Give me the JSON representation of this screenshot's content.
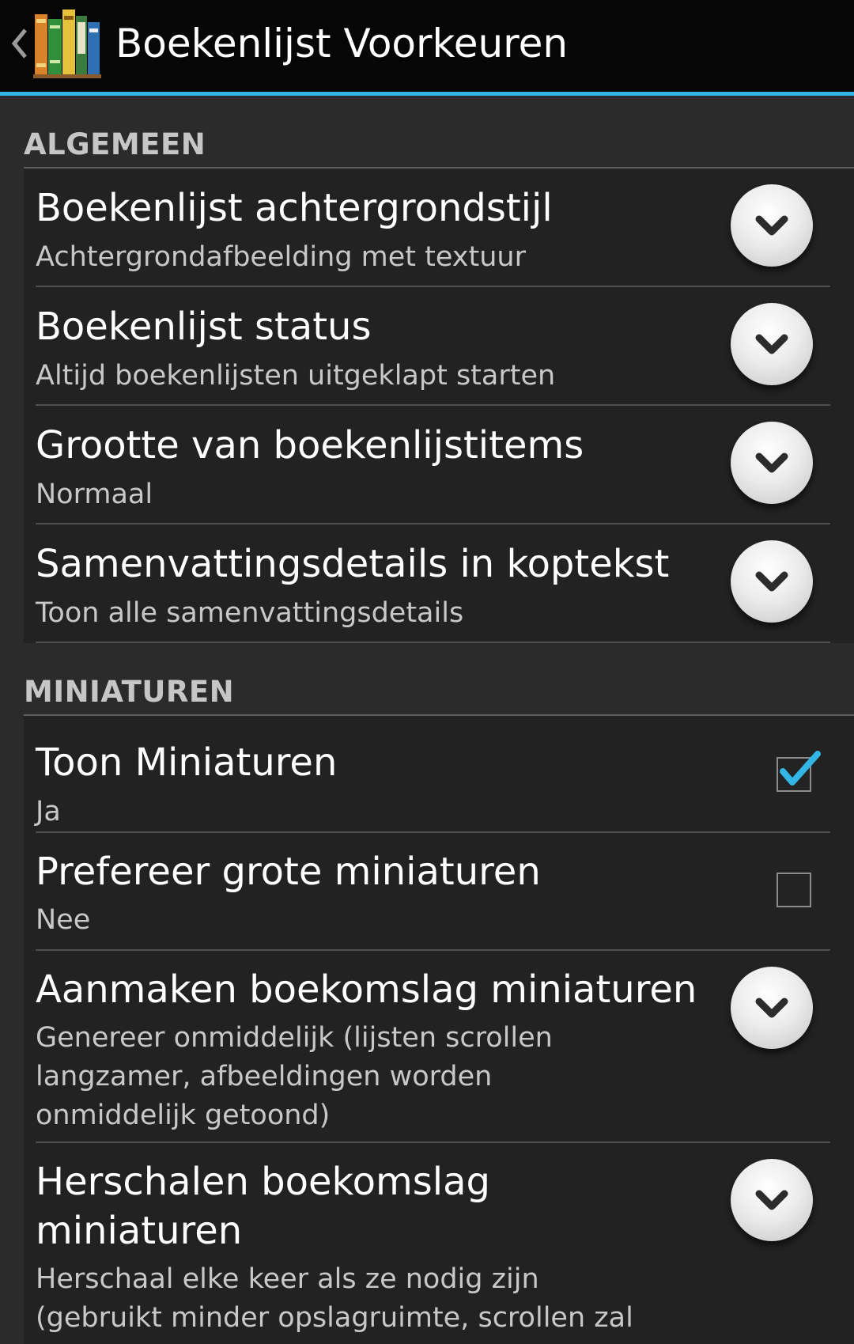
{
  "actionbar": {
    "title": "Boekenlijst Voorkeuren",
    "back_icon": "chevron-left-icon",
    "app_icon": "books-icon"
  },
  "colors": {
    "accent": "#33b5e5",
    "actionbar_bg": "#060606",
    "content_bg": "#2b2b2b",
    "section_bg": "#222222"
  },
  "sections": [
    {
      "header": "ALGEMEEN",
      "items": [
        {
          "title": "Boekenlijst achtergrondstijl",
          "summary": "Achtergrondafbeelding met textuur",
          "widget": "dropdown"
        },
        {
          "title": "Boekenlijst status",
          "summary": "Altijd boekenlijsten uitgeklapt starten",
          "widget": "dropdown"
        },
        {
          "title": "Grootte van boekenlijstitems",
          "summary": "Normaal",
          "widget": "dropdown"
        },
        {
          "title": "Samenvattingsdetails in koptekst",
          "summary": "Toon alle samenvattingsdetails",
          "widget": "dropdown"
        }
      ]
    },
    {
      "header": "MINIATUREN",
      "items": [
        {
          "title": "Toon Miniaturen",
          "summary": "Ja",
          "widget": "checkbox",
          "checked": true
        },
        {
          "title": "Prefereer grote miniaturen",
          "summary": "Nee",
          "widget": "checkbox",
          "checked": false
        },
        {
          "title": "Aanmaken boekomslag miniaturen",
          "summary": "Genereer onmiddelijk (lijsten scrollen langzamer, afbeeldingen worden onmiddelijk getoond)",
          "widget": "dropdown"
        },
        {
          "title": "Herschalen boekomslag miniaturen",
          "summary": "Herschaal elke keer als ze nodig zijn (gebruikt minder opslagruimte, scrollen zal",
          "widget": "dropdown"
        }
      ]
    }
  ]
}
